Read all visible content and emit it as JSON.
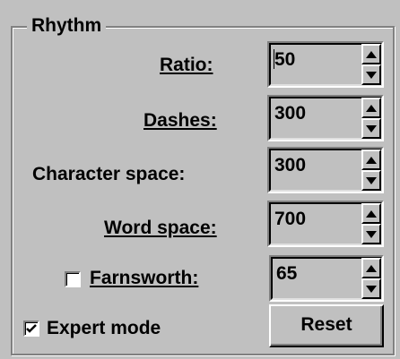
{
  "group": {
    "title": "Rhythm"
  },
  "fields": [
    {
      "label": "Ratio:",
      "value": "50"
    },
    {
      "label": "Dashes:",
      "value": "300"
    },
    {
      "label": "Character space:",
      "value": "300"
    },
    {
      "label": "Word space:",
      "value": "700"
    },
    {
      "label": "Farnsworth:",
      "value": "65"
    }
  ],
  "farnsworth": {
    "checked": false
  },
  "expert_mode": {
    "label": "Expert mode",
    "checked": true
  },
  "reset_button": {
    "label": "Reset"
  },
  "icons": {
    "spin_up": "arrow-up-icon",
    "spin_down": "arrow-down-icon",
    "check": "checkmark-icon"
  }
}
